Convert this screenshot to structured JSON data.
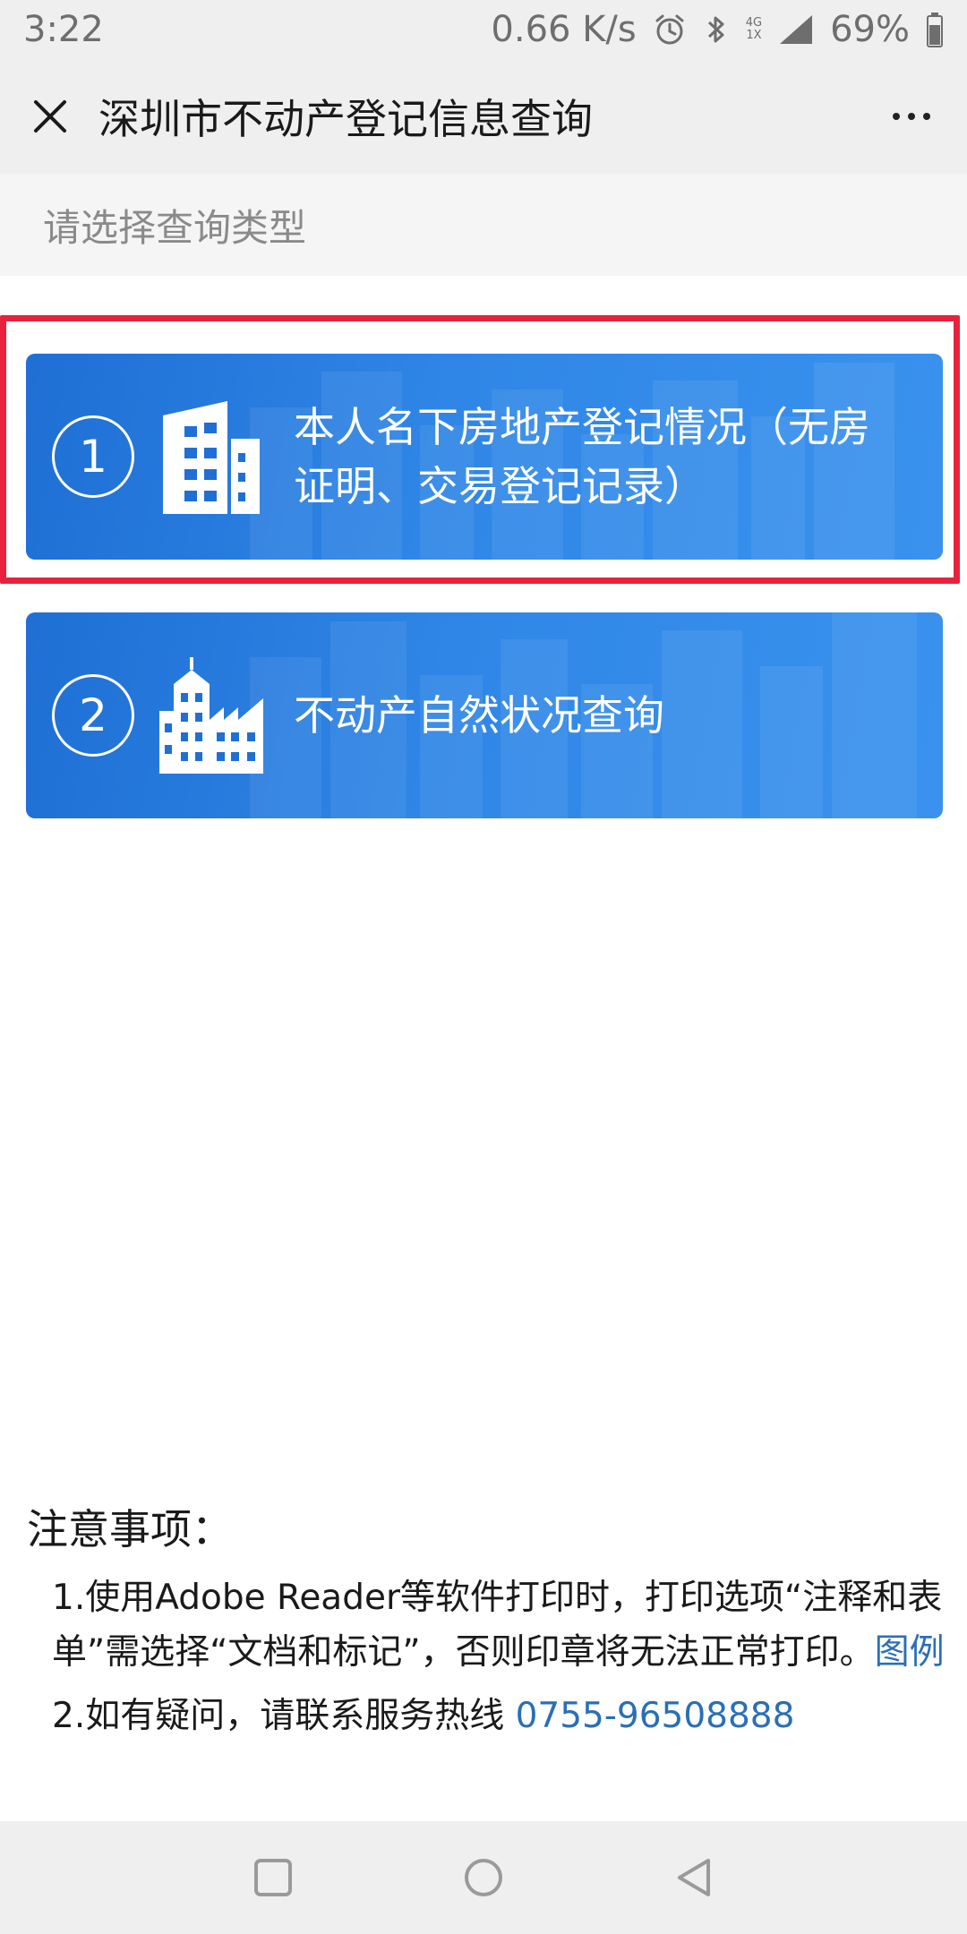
{
  "status_bar": {
    "time": "3:22",
    "speed": "0.66 K/s",
    "net_top": "4G",
    "net_bottom": "1X",
    "battery": "69%",
    "icons": [
      "alarm-icon",
      "bluetooth-icon",
      "signal-icon",
      "battery-icon"
    ]
  },
  "nav": {
    "title": "深圳市不动产登记信息查询",
    "close_icon": "close-icon",
    "more_icon": "more-icon"
  },
  "section_header": "请选择查询类型",
  "options": [
    {
      "number": "1",
      "label": "本人名下房地产登记情况（无房证明、交易登记记录）",
      "icon": "building-icon",
      "highlighted": true
    },
    {
      "number": "2",
      "label": "不动产自然状况查询",
      "icon": "city-buildings-icon",
      "highlighted": false
    }
  ],
  "notes": {
    "title": "注意事项：",
    "item1_text": "1.使用Adobe Reader等软件打印时，打印选项“注释和表单”需选择“文档和标记”，否则印章将无法正常打印。",
    "item1_link": "图例",
    "item2_text": "2.如有疑问，请联系服务热线 ",
    "item2_phone": "0755-96508888"
  },
  "colors": {
    "card_blue": "#2f86e6",
    "highlight_red": "#e8223d",
    "link_blue": "#2a6fb5"
  },
  "system_nav": [
    "recent-apps-icon",
    "home-icon",
    "back-icon"
  ]
}
